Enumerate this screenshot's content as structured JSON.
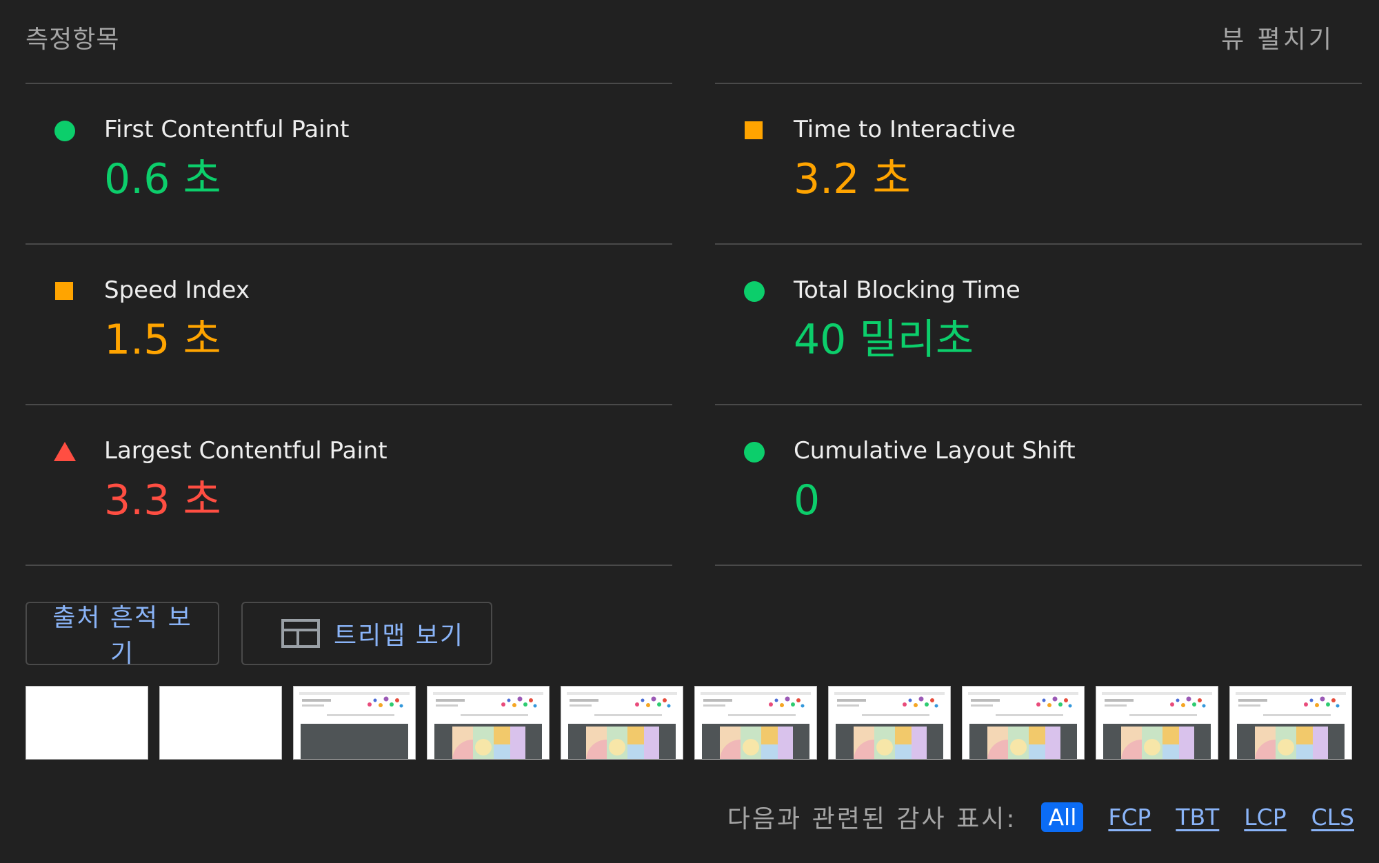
{
  "header": {
    "title": "측정항목",
    "expand_label": "뷰 펼치기"
  },
  "colors": {
    "pass": "#0cce6b",
    "average": "#ffa400",
    "fail": "#ff4e42",
    "link": "#8ab4f8",
    "active_chip": "#0b6cf5"
  },
  "metrics": {
    "fcp": {
      "label": "First Contentful Paint",
      "value": "0.6 초",
      "rating": "pass",
      "icon": "circle-icon"
    },
    "tti": {
      "label": "Time to Interactive",
      "value": "3.2 초",
      "rating": "average",
      "icon": "square-icon"
    },
    "si": {
      "label": "Speed Index",
      "value": "1.5 초",
      "rating": "average",
      "icon": "square-icon"
    },
    "tbt": {
      "label": "Total Blocking Time",
      "value": "40 밀리초",
      "rating": "pass",
      "icon": "circle-icon"
    },
    "lcp": {
      "label": "Largest Contentful Paint",
      "value": "3.3 초",
      "rating": "fail",
      "icon": "triangle-icon"
    },
    "cls": {
      "label": "Cumulative Layout Shift",
      "value": "0",
      "rating": "pass",
      "icon": "circle-icon"
    }
  },
  "buttons": {
    "trace": "출처 흔적 보기",
    "treemap": "트리맵 보기"
  },
  "filmstrip": {
    "frame_count": 10,
    "blank_frames": 2
  },
  "filter": {
    "label": "다음과 관련된 감사 표시:",
    "chips": [
      "All",
      "FCP",
      "TBT",
      "LCP",
      "CLS"
    ],
    "active": "All"
  }
}
